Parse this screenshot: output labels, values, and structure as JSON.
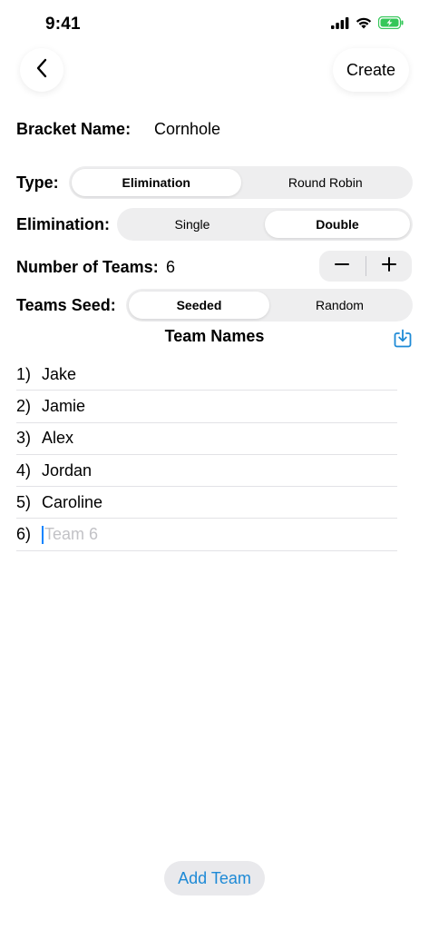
{
  "status_bar": {
    "time": "9:41"
  },
  "nav": {
    "create_label": "Create"
  },
  "bracket": {
    "name_label": "Bracket Name:",
    "name_value": "Cornhole"
  },
  "type": {
    "label": "Type:",
    "options": [
      "Elimination",
      "Round Robin"
    ],
    "selected": "Elimination"
  },
  "elimination": {
    "label": "Elimination:",
    "options": [
      "Single",
      "Double"
    ],
    "selected": "Double"
  },
  "teams_count": {
    "label": "Number of Teams:",
    "value": "6"
  },
  "seed": {
    "label": "Teams Seed:",
    "options": [
      "Seeded",
      "Random"
    ],
    "selected": "Seeded"
  },
  "team_names": {
    "title": "Team Names",
    "teams": [
      {
        "num": "1)",
        "name": "Jake"
      },
      {
        "num": "2)",
        "name": "Jamie"
      },
      {
        "num": "3)",
        "name": "Alex"
      },
      {
        "num": "4)",
        "name": "Jordan"
      },
      {
        "num": "5)",
        "name": "Caroline"
      },
      {
        "num": "6)",
        "name": "",
        "placeholder": "Team 6"
      }
    ]
  },
  "add_team_label": "Add Team",
  "colors": {
    "accent": "#1e8ad6",
    "battery": "#34c759",
    "segment_bg": "#eeeeef"
  },
  "icons": [
    "back-chevron-icon",
    "minus-icon",
    "plus-icon",
    "import-icon",
    "signal-icon",
    "wifi-icon",
    "battery-icon"
  ]
}
